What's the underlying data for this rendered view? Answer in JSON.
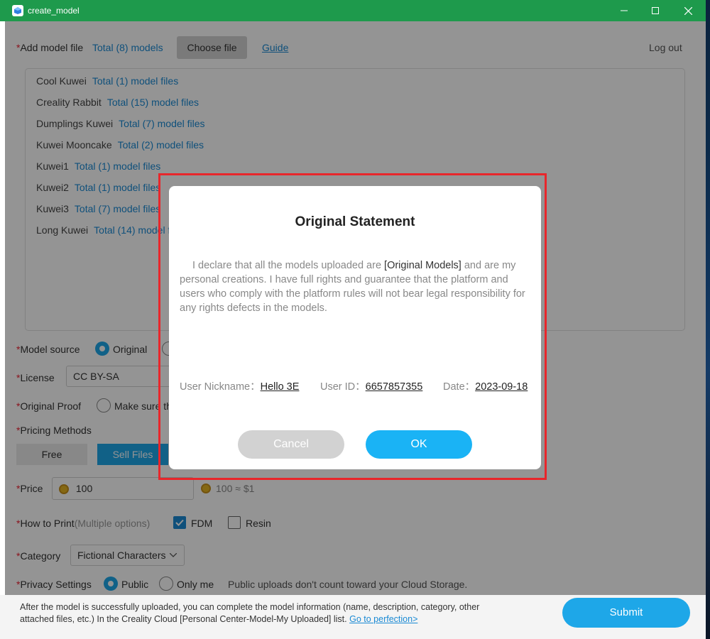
{
  "window": {
    "title": "create_model",
    "colors": {
      "titlebar": "#1e9a4c",
      "accent": "#1ea7e8",
      "link": "#1a8ad4",
      "required": "#e23"
    }
  },
  "add_model": {
    "required_mark": "*",
    "label": "Add model file",
    "total": "Total (8) models",
    "choose_file": "Choose file",
    "guide": "Guide",
    "logout": "Log out"
  },
  "models": [
    {
      "name": "Cool Kuwei",
      "count": "Total (1) model files"
    },
    {
      "name": "Creality Rabbit",
      "count": "Total (15) model files"
    },
    {
      "name": "Dumplings Kuwei",
      "count": "Total (7) model files"
    },
    {
      "name": "Kuwei Mooncake",
      "count": "Total (2) model files"
    },
    {
      "name": "Kuwei1",
      "count": "Total (1) model files"
    },
    {
      "name": "Kuwei2",
      "count": "Total (1) model files"
    },
    {
      "name": "Kuwei3",
      "count": "Total (7) model files"
    },
    {
      "name": "Long Kuwei",
      "count": "Total (14) model files"
    }
  ],
  "form": {
    "model_source": {
      "label": "Model source",
      "option_original": "Original"
    },
    "license": {
      "label": "License",
      "value": "CC BY-SA"
    },
    "original_proof": {
      "label": "Original Proof",
      "text": "Make sure th"
    },
    "pricing": {
      "label": "Pricing Methods",
      "free": "Free",
      "sell": "Sell Files"
    },
    "price": {
      "label": "Price",
      "value": "100",
      "rate": "100 ≈ $1"
    },
    "print": {
      "label": "How to Print",
      "hint": "(Multiple options)",
      "fdm": "FDM",
      "fdm_checked": true,
      "resin": "Resin",
      "resin_checked": false
    },
    "category": {
      "label": "Category",
      "value": "Fictional Characters"
    },
    "privacy": {
      "label": "Privacy Settings",
      "public": "Public",
      "only_me": "Only me",
      "note": "Public uploads don't count toward your Cloud Storage."
    }
  },
  "footer": {
    "text": "After the model is successfully uploaded, you can complete the model information (name, description, category, other attached files, etc.) In the Creality Cloud [Personal Center-Model-My Uploaded] list.",
    "link": "Go to perfection>",
    "submit": "Submit"
  },
  "dialog": {
    "title": "Original Statement",
    "body_prefix": "I declare that all the models uploaded are ",
    "body_highlight": "[Original Models]",
    "body_suffix": " and are my personal creations. I have full rights and guarantee that the platform and users who comply with the platform rules will not bear legal responsibility for any rights defects in the models.",
    "nickname_label": "User Nickname：",
    "nickname": "Hello 3E",
    "userid_label": "User ID：",
    "userid": "6657857355",
    "date_label": "Date：",
    "date": "2023-09-18",
    "cancel": "Cancel",
    "ok": "OK"
  }
}
